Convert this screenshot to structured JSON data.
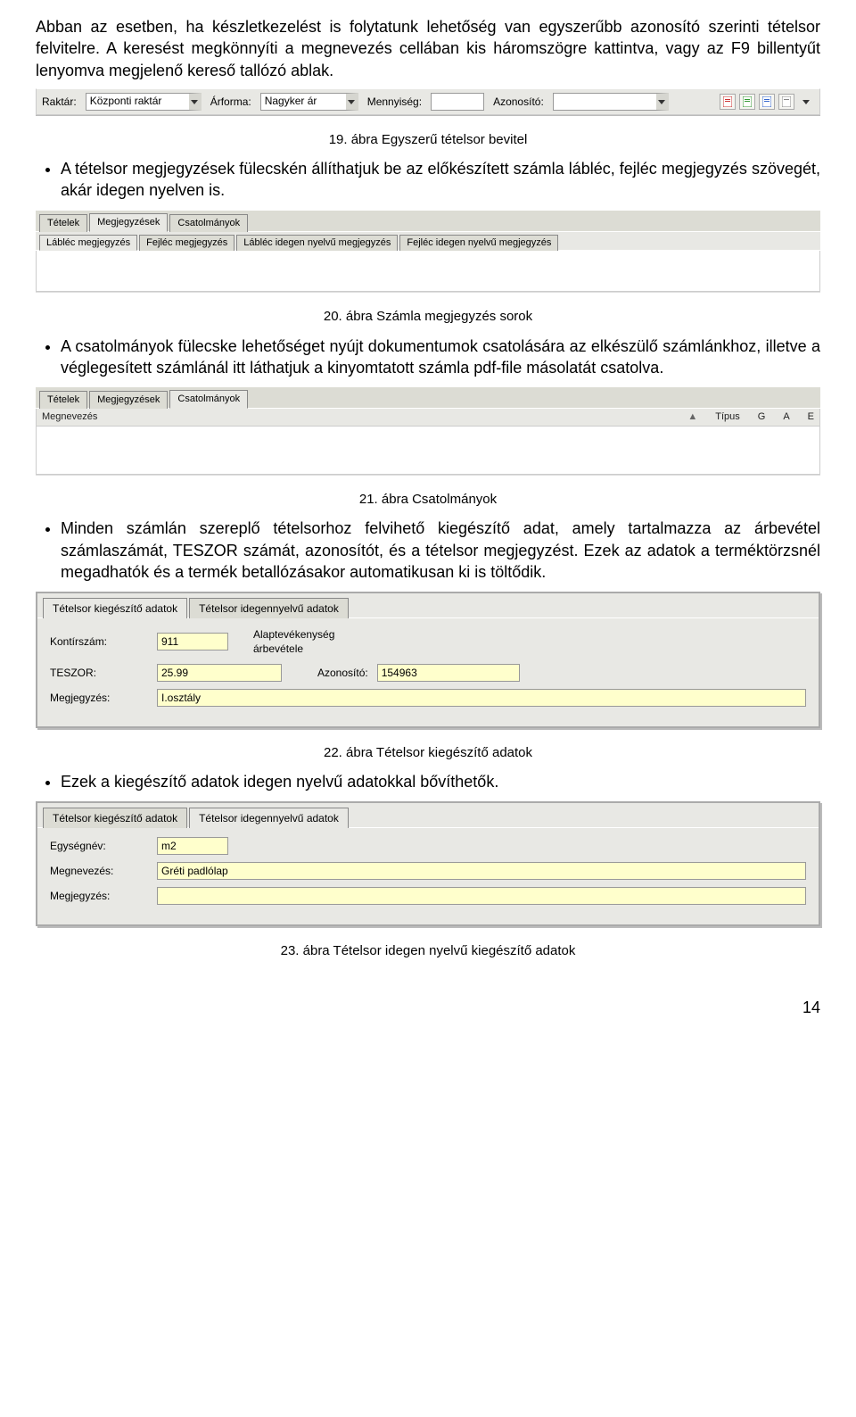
{
  "intro": {
    "p1": "Abban az esetben, ha készletkezelést is folytatunk lehetőség van egyszerűbb azonosító szerinti tételsor felvitelre. A keresést megkönnyíti a megnevezés cellában kis háromszögre kattintva, vagy az F9 billentyűt lenyomva megjelenő kereső tallózó ablak."
  },
  "fig19": {
    "raktar_label": "Raktár:",
    "raktar_value": "Központi raktár",
    "arforma_label": "Árforma:",
    "arforma_value": "Nagyker ár",
    "mennyiseg_label": "Mennyiség:",
    "azonosito_label": "Azonosító:",
    "caption": "19. ábra Egyszerű tételsor bevitel"
  },
  "bullet1": "A tételsor megjegyzések fülecskén állíthatjuk be az előkészített számla lábléc, fejléc megjegyzés szövegét, akár idegen nyelven is.",
  "fig20": {
    "top_tabs": [
      "Tételek",
      "Megjegyzések",
      "Csatolmányok"
    ],
    "sub_tabs": [
      "Lábléc megjegyzés",
      "Fejléc megjegyzés",
      "Lábléc idegen nyelvű megjegyzés",
      "Fejléc idegen nyelvű megjegyzés"
    ],
    "caption": "20. ábra Számla megjegyzés sorok"
  },
  "bullet2": "A csatolmányok fülecske lehetőséget nyújt dokumentumok csatolására az elkészülő számlánkhoz, illetve a véglegesített számlánál itt láthatjuk a kinyomtatott számla pdf-file másolatát csatolva.",
  "fig21": {
    "top_tabs": [
      "Tételek",
      "Megjegyzések",
      "Csatolmányok"
    ],
    "col_left": "Megnevezés",
    "cols_right": [
      "Típus",
      "G",
      "A",
      "E"
    ],
    "caption": "21. ábra Csatolmányok"
  },
  "bullet3": "Minden számlán szereplő tételsorhoz felvihető kiegészítő adat, amely tartalmazza az árbevétel számlaszámát, TESZOR számát, azonosítót, és a tételsor megjegyzést. Ezek az adatok a terméktörzsnél megadhatók és a termék betallózásakor automatikusan ki is töltődik.",
  "fig22": {
    "tabs": [
      "Tételsor kiegészítő adatok",
      "Tételsor idegennyelvű adatok"
    ],
    "kontir_label": "Kontírszám:",
    "kontir_value": "911",
    "kontir_desc": "Alaptevékenység árbevétele",
    "teszor_label": "TESZOR:",
    "teszor_value": "25.99",
    "azonosito2_label": "Azonosító:",
    "azonosito2_value": "154963",
    "megj_label": "Megjegyzés:",
    "megj_value": "I.osztály",
    "caption": "22. ábra Tételsor kiegészítő adatok"
  },
  "bullet4": "Ezek a kiegészítő adatok idegen nyelvű adatokkal bővíthetők.",
  "fig23": {
    "tabs": [
      "Tételsor kiegészítő adatok",
      "Tételsor idegennyelvű adatok"
    ],
    "egysegnev_label": "Egységnév:",
    "egysegnev_value": "m2",
    "megnev_label": "Megnevezés:",
    "megnev_value": "Gréti padlólap",
    "megj2_label": "Megjegyzés:",
    "caption": "23. ábra Tételsor idegen nyelvű kiegészítő adatok"
  },
  "pagenum": "14"
}
